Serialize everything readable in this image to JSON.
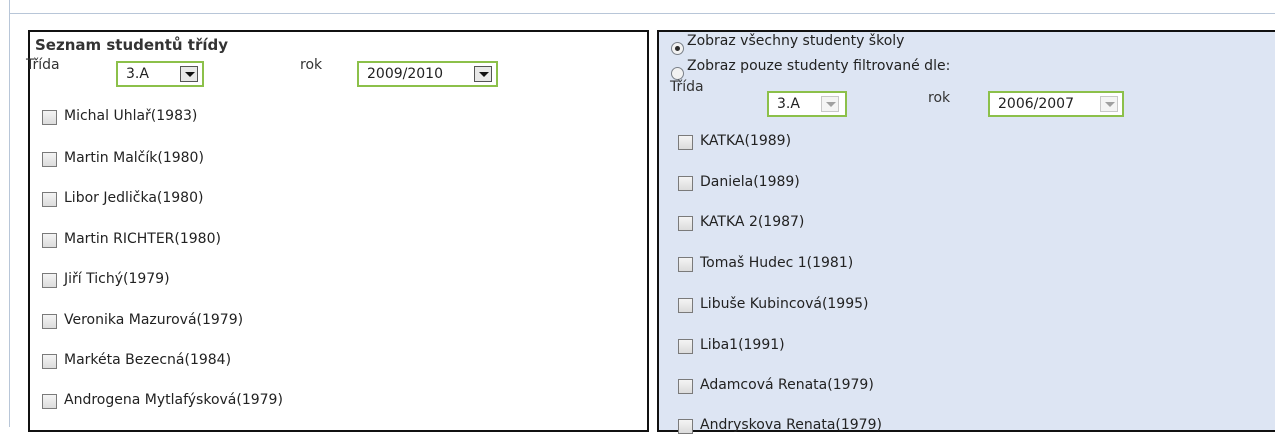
{
  "left_panel": {
    "title": "Seznam studentů třídy",
    "class_label": "Třída",
    "class_value": "3.A",
    "year_label": "rok",
    "year_value": "2009/2010",
    "students": [
      "Michal Uhlař(1983)",
      "Martin Malčík(1980)",
      "Libor Jedlička(1980)",
      "Martin RICHTER(1980)",
      "Jiří Tichý(1979)",
      "Veronika Mazurová(1979)",
      "Markéta Bezecná(1984)",
      "Androgena Mytlafýsková(1979)"
    ]
  },
  "right_panel": {
    "radio_all_label": "Zobraz všechny studenty školy",
    "radio_filtered_label": "Zobraz pouze studenty filtrované dle:",
    "selected_radio": "all",
    "class_label": "Třída",
    "class_value": "3.A",
    "year_label": "rok",
    "year_value": "2006/2007",
    "students": [
      "KATKA(1989)",
      "Daniela(1989)",
      "KATKA 2(1987)",
      "Tomaš Hudec 1(1981)",
      "Libuše Kubincová(1995)",
      "Liba1(1991)",
      "Adamcová Renata(1979)",
      "Andryskova Renata(1979)"
    ]
  },
  "colors": {
    "select_border": "#8cc04a",
    "right_panel_bg": "#dde5f3",
    "frame_line": "#b8c6d8"
  }
}
